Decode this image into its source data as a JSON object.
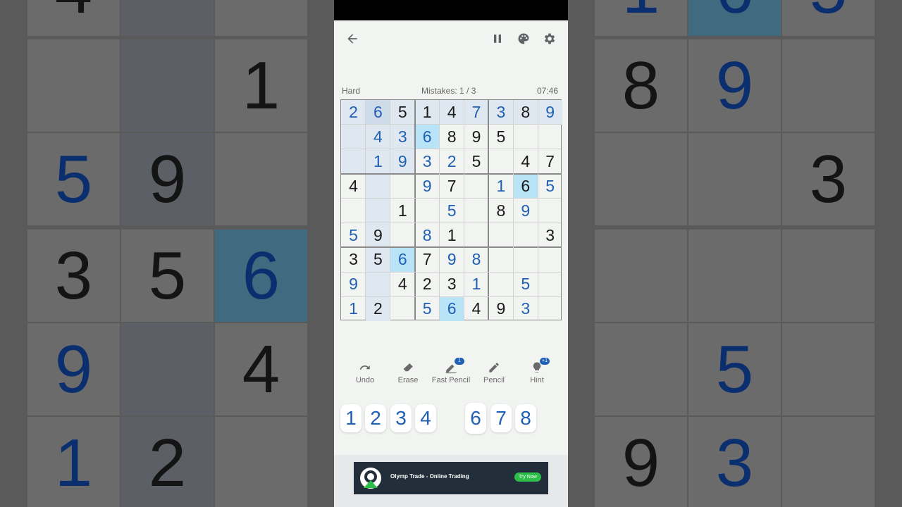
{
  "app": {
    "difficulty": "Hard",
    "mistakes": "Mistakes: 1 / 3",
    "timer": "07:46"
  },
  "icons": {
    "back": "back-arrow-icon",
    "pause": "pause-icon",
    "theme": "palette-icon",
    "settings": "gear-icon"
  },
  "board": [
    [
      {
        "v": "2",
        "t": "u"
      },
      {
        "v": "6",
        "t": "u"
      },
      {
        "v": "5",
        "t": "g"
      },
      {
        "v": "1",
        "t": "g"
      },
      {
        "v": "4",
        "t": "g"
      },
      {
        "v": "7",
        "t": "u"
      },
      {
        "v": "3",
        "t": "u"
      },
      {
        "v": "8",
        "t": "g"
      },
      {
        "v": "9",
        "t": "u"
      }
    ],
    [
      {
        "v": "",
        "t": ""
      },
      {
        "v": "4",
        "t": "u"
      },
      {
        "v": "3",
        "t": "u"
      },
      {
        "v": "6",
        "t": "u"
      },
      {
        "v": "8",
        "t": "g"
      },
      {
        "v": "9",
        "t": "g"
      },
      {
        "v": "5",
        "t": "g"
      },
      {
        "v": "",
        "t": ""
      },
      {
        "v": "",
        "t": ""
      }
    ],
    [
      {
        "v": "",
        "t": ""
      },
      {
        "v": "1",
        "t": "u"
      },
      {
        "v": "9",
        "t": "u"
      },
      {
        "v": "3",
        "t": "u"
      },
      {
        "v": "2",
        "t": "u"
      },
      {
        "v": "5",
        "t": "g"
      },
      {
        "v": "",
        "t": ""
      },
      {
        "v": "4",
        "t": "g"
      },
      {
        "v": "7",
        "t": "g"
      }
    ],
    [
      {
        "v": "4",
        "t": "g"
      },
      {
        "v": "",
        "t": ""
      },
      {
        "v": "",
        "t": ""
      },
      {
        "v": "9",
        "t": "u"
      },
      {
        "v": "7",
        "t": "g"
      },
      {
        "v": "",
        "t": ""
      },
      {
        "v": "1",
        "t": "u"
      },
      {
        "v": "6",
        "t": "g"
      },
      {
        "v": "5",
        "t": "u"
      }
    ],
    [
      {
        "v": "",
        "t": ""
      },
      {
        "v": "",
        "t": ""
      },
      {
        "v": "1",
        "t": "g"
      },
      {
        "v": "",
        "t": ""
      },
      {
        "v": "5",
        "t": "u"
      },
      {
        "v": "",
        "t": ""
      },
      {
        "v": "8",
        "t": "g"
      },
      {
        "v": "9",
        "t": "u"
      },
      {
        "v": "",
        "t": ""
      }
    ],
    [
      {
        "v": "5",
        "t": "u"
      },
      {
        "v": "9",
        "t": "g"
      },
      {
        "v": "",
        "t": ""
      },
      {
        "v": "8",
        "t": "u"
      },
      {
        "v": "1",
        "t": "g"
      },
      {
        "v": "",
        "t": ""
      },
      {
        "v": "",
        "t": ""
      },
      {
        "v": "",
        "t": ""
      },
      {
        "v": "3",
        "t": "g"
      }
    ],
    [
      {
        "v": "3",
        "t": "g"
      },
      {
        "v": "5",
        "t": "g"
      },
      {
        "v": "6",
        "t": "u"
      },
      {
        "v": "7",
        "t": "g"
      },
      {
        "v": "9",
        "t": "u"
      },
      {
        "v": "8",
        "t": "u"
      },
      {
        "v": "",
        "t": ""
      },
      {
        "v": "",
        "t": ""
      },
      {
        "v": "",
        "t": ""
      }
    ],
    [
      {
        "v": "9",
        "t": "u"
      },
      {
        "v": "",
        "t": ""
      },
      {
        "v": "4",
        "t": "g"
      },
      {
        "v": "2",
        "t": "g"
      },
      {
        "v": "3",
        "t": "g"
      },
      {
        "v": "1",
        "t": "u"
      },
      {
        "v": "",
        "t": ""
      },
      {
        "v": "5",
        "t": "u"
      },
      {
        "v": "",
        "t": ""
      }
    ],
    [
      {
        "v": "1",
        "t": "u"
      },
      {
        "v": "2",
        "t": "g"
      },
      {
        "v": "",
        "t": ""
      },
      {
        "v": "5",
        "t": "u"
      },
      {
        "v": "6",
        "t": "u"
      },
      {
        "v": "4",
        "t": "g"
      },
      {
        "v": "9",
        "t": "g"
      },
      {
        "v": "3",
        "t": "u"
      },
      {
        "v": "",
        "t": ""
      }
    ]
  ],
  "selected": {
    "row": 0,
    "col": 1
  },
  "same_value_cells": [
    [
      1,
      3
    ],
    [
      3,
      7
    ],
    [
      6,
      2
    ],
    [
      8,
      4
    ]
  ],
  "tools": {
    "undo": "Undo",
    "erase": "Erase",
    "fast_pencil": "Fast Pencil",
    "fast_pencil_badge": "1",
    "pencil": "Pencil",
    "hint": "Hint",
    "hint_badge": "+1"
  },
  "numpad": [
    "1",
    "2",
    "3",
    "4",
    "",
    "6",
    "7",
    "8",
    ""
  ],
  "ad": {
    "title": "Olymp Trade - Online Trading",
    "cta": "Try Now"
  },
  "background": {
    "left": [
      "4",
      "",
      "",
      "1",
      "5",
      "9",
      "",
      "3",
      "5",
      "6",
      "9",
      "",
      "4",
      "1",
      "2",
      ""
    ],
    "right": [
      "1",
      "6",
      "5",
      "8",
      "9",
      "",
      "",
      "",
      "3",
      "",
      "",
      "",
      "",
      "5",
      "",
      "9",
      "3",
      ""
    ]
  },
  "colors": {
    "accent": "#1f5fb4",
    "selected": "#cfdbe8",
    "highlight": "#dfe8f0",
    "same_value": "#b9e3f7"
  }
}
